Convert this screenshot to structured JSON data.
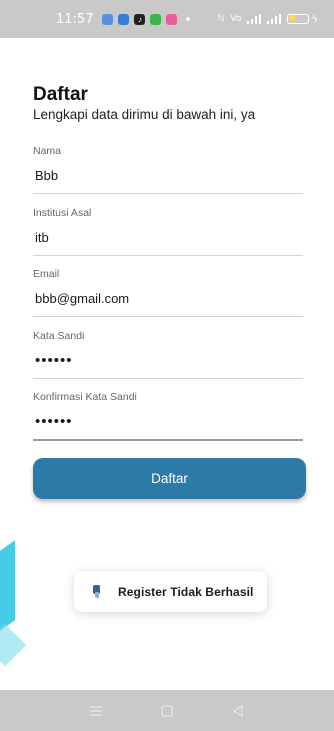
{
  "status_bar": {
    "time": "11:57",
    "signal_text": "Vo",
    "battery_level": 0.35,
    "colors": {
      "background": "#c9c9c9",
      "battery_fill": "#ffd84d"
    }
  },
  "form": {
    "title": "Daftar",
    "subtitle": "Lengkapi data dirimu di bawah ini, ya",
    "fields": [
      {
        "label": "Nama",
        "value": "Bbb"
      },
      {
        "label": "Institusi Asal",
        "value": "itb"
      },
      {
        "label": "Email",
        "value": "bbb@gmail.com"
      },
      {
        "label": "Kata Sandi",
        "value": "••••••"
      },
      {
        "label": "Konfirmasi Kata Sandi",
        "value": "••••••"
      }
    ],
    "submit_label": "Daftar",
    "colors": {
      "button": "#2d79a7",
      "button_text": "#ffffff"
    }
  },
  "toast": {
    "message": "Register Tidak Berhasil",
    "icon": "app-icon"
  },
  "nav_bar": {
    "icons": [
      "menu-icon",
      "home-icon",
      "back-icon"
    ]
  }
}
